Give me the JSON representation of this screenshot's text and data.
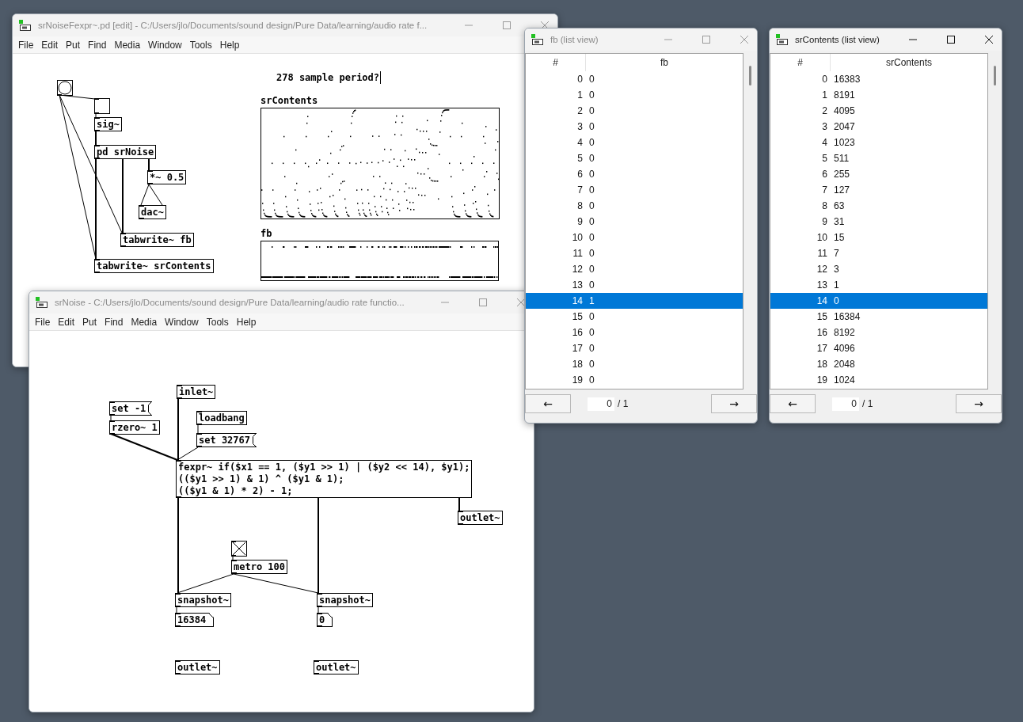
{
  "windows": [
    {
      "kind": "patch",
      "title": "srNoiseFexpr~.pd [edit] - C:/Users/jlo/Documents/sound design/Pure Data/learning/audio rate f...",
      "active": false,
      "menu": [
        "File",
        "Edit",
        "Put",
        "Find",
        "Media",
        "Window",
        "Tools",
        "Help"
      ],
      "objects": [
        {
          "kind": "bang"
        },
        {
          "kind": "toggle",
          "checked": false
        },
        {
          "kind": "object",
          "text": "sig~"
        },
        {
          "kind": "object",
          "text": "pd srNoise"
        },
        {
          "kind": "object",
          "text": "*~ 0.5"
        },
        {
          "kind": "object",
          "text": "dac~"
        },
        {
          "kind": "object",
          "text": "tabwrite~ fb"
        },
        {
          "kind": "object",
          "text": "tabwrite~ srContents"
        },
        {
          "kind": "comment",
          "text": "278 sample period?",
          "editing": true
        },
        {
          "kind": "graph",
          "label": "srContents"
        },
        {
          "kind": "graph",
          "label": "fb"
        }
      ]
    },
    {
      "kind": "patch",
      "title": "srNoise - C:/Users/jlo/Documents/sound design/Pure Data/learning/audio rate functio...",
      "active": false,
      "menu": [
        "File",
        "Edit",
        "Put",
        "Find",
        "Media",
        "Window",
        "Tools",
        "Help"
      ],
      "objects": [
        {
          "kind": "object",
          "text": "inlet~"
        },
        {
          "kind": "message",
          "text": "set -1"
        },
        {
          "kind": "object",
          "text": "rzero~ 1"
        },
        {
          "kind": "object",
          "text": "loadbang"
        },
        {
          "kind": "message",
          "text": "set 32767"
        },
        {
          "kind": "object",
          "text": "fexpr~ if($x1 == 1, ($y1 >> 1) | ($y2 << 14), $y1);\n(($y1 >> 1) & 1) ^ ($y1 & 1);\n(($y1 & 1) * 2) - 1;"
        },
        {
          "kind": "object",
          "text": "outlet~"
        },
        {
          "kind": "toggle",
          "checked": true
        },
        {
          "kind": "object",
          "text": "metro 100"
        },
        {
          "kind": "object",
          "text": "snapshot~"
        },
        {
          "kind": "object",
          "text": "snapshot~"
        },
        {
          "kind": "number",
          "text": "16384"
        },
        {
          "kind": "number",
          "text": "0"
        },
        {
          "kind": "object",
          "text": "outlet~"
        },
        {
          "kind": "object",
          "text": "outlet~"
        }
      ]
    },
    {
      "kind": "list",
      "title": "fb (list view)",
      "active": false,
      "columns": [
        "#",
        "fb"
      ],
      "rows": [
        {
          "index": "0",
          "value": "0",
          "selected": false
        },
        {
          "index": "1",
          "value": "0",
          "selected": false
        },
        {
          "index": "2",
          "value": "0",
          "selected": false
        },
        {
          "index": "3",
          "value": "0",
          "selected": false
        },
        {
          "index": "4",
          "value": "0",
          "selected": false
        },
        {
          "index": "5",
          "value": "0",
          "selected": false
        },
        {
          "index": "6",
          "value": "0",
          "selected": false
        },
        {
          "index": "7",
          "value": "0",
          "selected": false
        },
        {
          "index": "8",
          "value": "0",
          "selected": false
        },
        {
          "index": "9",
          "value": "0",
          "selected": false
        },
        {
          "index": "10",
          "value": "0",
          "selected": false
        },
        {
          "index": "11",
          "value": "0",
          "selected": false
        },
        {
          "index": "12",
          "value": "0",
          "selected": false
        },
        {
          "index": "13",
          "value": "0",
          "selected": false
        },
        {
          "index": "14",
          "value": "1",
          "selected": true
        },
        {
          "index": "15",
          "value": "0",
          "selected": false
        },
        {
          "index": "16",
          "value": "0",
          "selected": false
        },
        {
          "index": "17",
          "value": "0",
          "selected": false
        },
        {
          "index": "18",
          "value": "0",
          "selected": false
        },
        {
          "index": "19",
          "value": "0",
          "selected": false
        }
      ],
      "prev": "←",
      "page": "0",
      "page_total": "/ 1",
      "next": "→"
    },
    {
      "kind": "list",
      "title": "srContents (list view)",
      "active": true,
      "columns": [
        "#",
        "srContents"
      ],
      "rows": [
        {
          "index": "0",
          "value": "16383",
          "selected": false
        },
        {
          "index": "1",
          "value": "8191",
          "selected": false
        },
        {
          "index": "2",
          "value": "4095",
          "selected": false
        },
        {
          "index": "3",
          "value": "2047",
          "selected": false
        },
        {
          "index": "4",
          "value": "1023",
          "selected": false
        },
        {
          "index": "5",
          "value": "511",
          "selected": false
        },
        {
          "index": "6",
          "value": "255",
          "selected": false
        },
        {
          "index": "7",
          "value": "127",
          "selected": false
        },
        {
          "index": "8",
          "value": "63",
          "selected": false
        },
        {
          "index": "9",
          "value": "31",
          "selected": false
        },
        {
          "index": "10",
          "value": "15",
          "selected": false
        },
        {
          "index": "11",
          "value": "7",
          "selected": false
        },
        {
          "index": "12",
          "value": "3",
          "selected": false
        },
        {
          "index": "13",
          "value": "1",
          "selected": false
        },
        {
          "index": "14",
          "value": "0",
          "selected": true
        },
        {
          "index": "15",
          "value": "16384",
          "selected": false
        },
        {
          "index": "16",
          "value": "8192",
          "selected": false
        },
        {
          "index": "17",
          "value": "4096",
          "selected": false
        },
        {
          "index": "18",
          "value": "2048",
          "selected": false
        },
        {
          "index": "19",
          "value": "1024",
          "selected": false
        }
      ],
      "prev": "←",
      "page": "0",
      "page_total": "/ 1",
      "next": "→"
    }
  ]
}
